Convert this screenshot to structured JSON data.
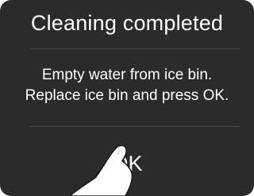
{
  "dialog": {
    "title": "Cleaning completed",
    "message_line1": "Empty water from ice bin.",
    "message_line2": "Replace ice bin and press OK.",
    "ok_label": "OK"
  },
  "icons": {
    "pointer": "pointing-hand-icon"
  },
  "colors": {
    "background": "#2b2b2b",
    "text": "#ffffff",
    "divider": "#4a4a4a"
  }
}
